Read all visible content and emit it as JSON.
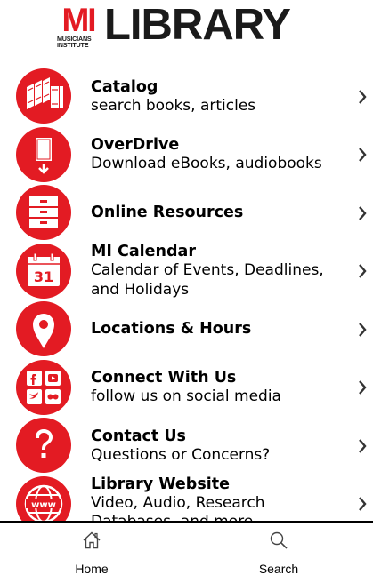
{
  "header": {
    "logo_mark": "MI",
    "logo_sub_1": "MUSICIANS",
    "logo_sub_2": "INSTITUTE",
    "logo_word": "LIBRARY"
  },
  "colors": {
    "brand_red": "#e31b23",
    "text": "#000000"
  },
  "menu": [
    {
      "icon": "books-icon",
      "title": "Catalog",
      "subtitle": "search books, articles"
    },
    {
      "icon": "ebook-download-icon",
      "title": "OverDrive",
      "subtitle": "Download eBooks, audiobooks"
    },
    {
      "icon": "file-cabinet-icon",
      "title": "Online Resources",
      "subtitle": ""
    },
    {
      "icon": "calendar-icon",
      "title": "MI Calendar",
      "subtitle": "Calendar of Events, Deadlines, and Holidays"
    },
    {
      "icon": "map-pin-icon",
      "title": "Locations & Hours",
      "subtitle": ""
    },
    {
      "icon": "social-media-icon",
      "title": "Connect With Us",
      "subtitle": "follow us on social media"
    },
    {
      "icon": "question-mark-icon",
      "title": "Contact Us",
      "subtitle": "Questions or Concerns?"
    },
    {
      "icon": "www-globe-icon",
      "title": "Library Website",
      "subtitle": "Video, Audio, Research Databases, and more"
    }
  ],
  "calendar_day": "31",
  "tabs": [
    {
      "icon": "home-icon",
      "label": "Home"
    },
    {
      "icon": "search-icon",
      "label": "Search"
    }
  ]
}
